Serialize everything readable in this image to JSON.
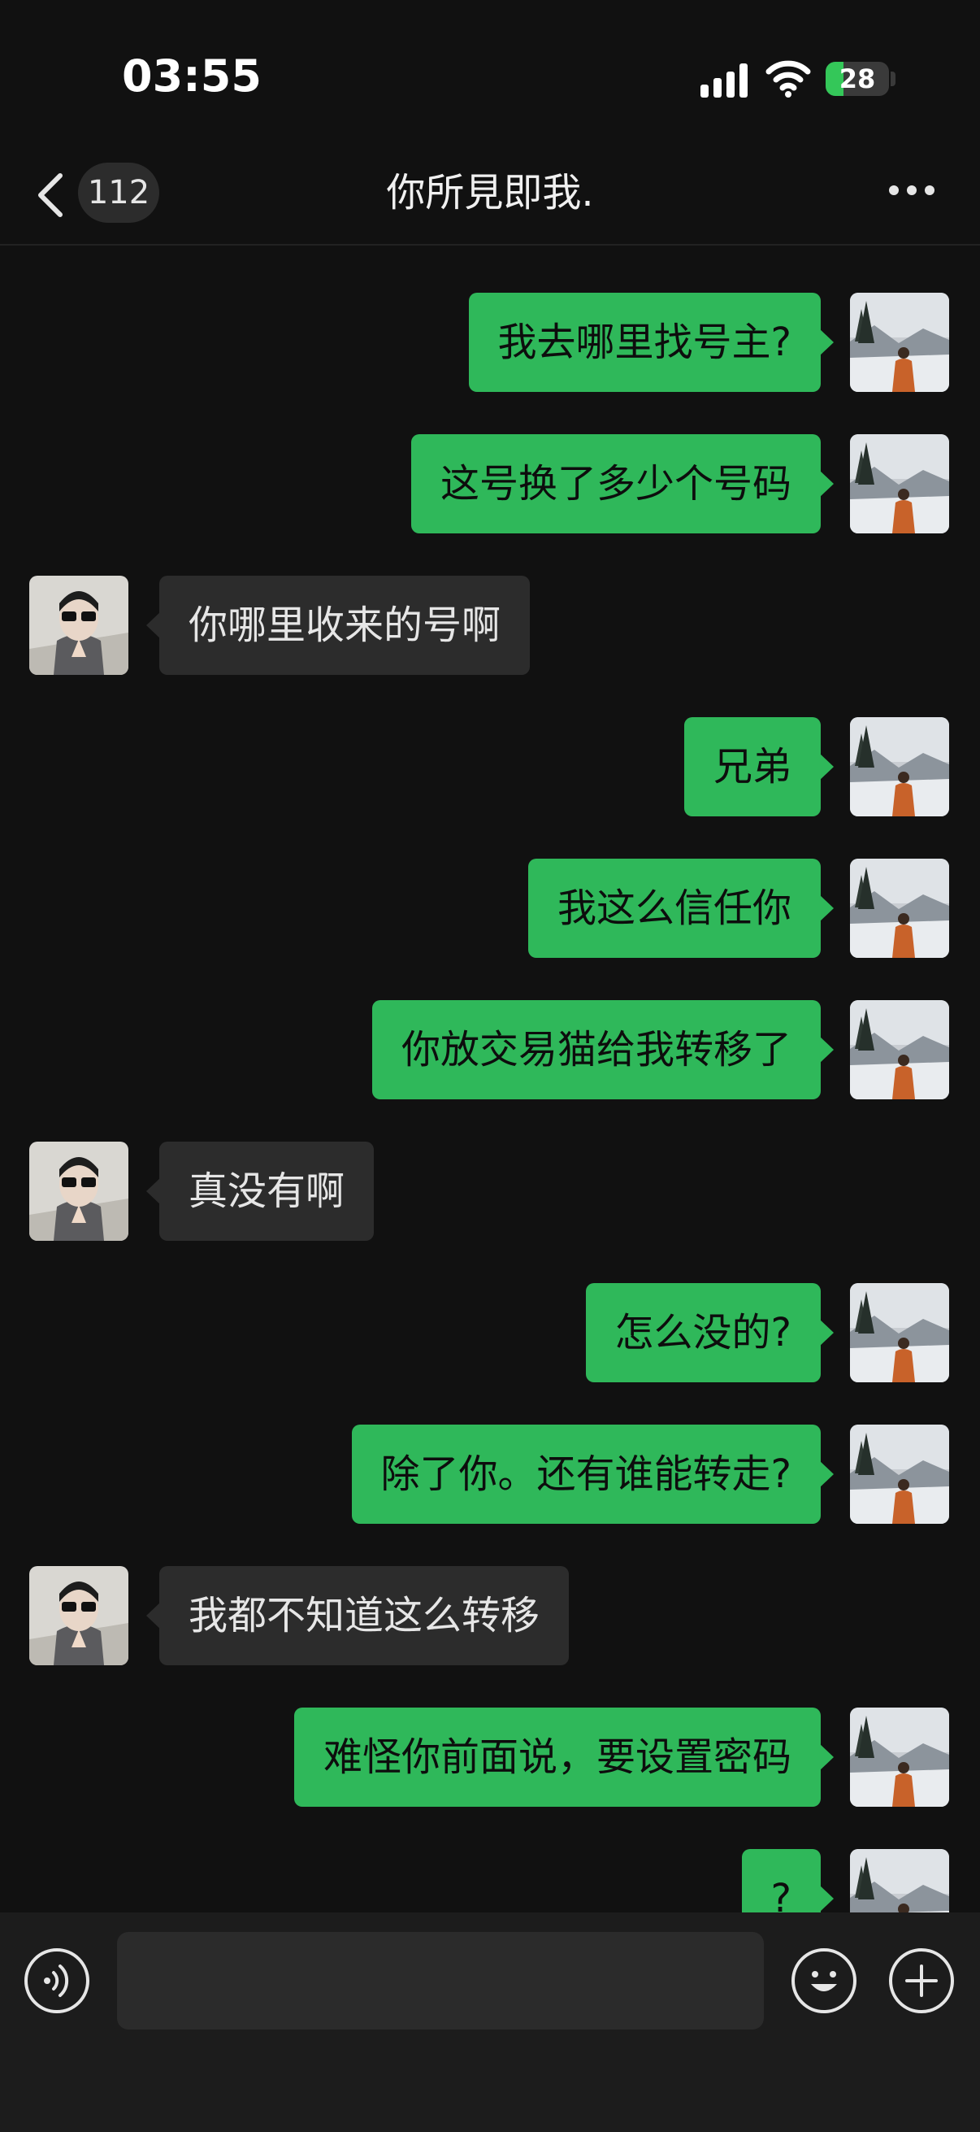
{
  "status_bar": {
    "time": "03:55",
    "battery": "28",
    "battery_level": 0.28,
    "icons": [
      "cellular-signal-icon",
      "wifi-icon",
      "battery-charging-icon"
    ]
  },
  "nav": {
    "back_icon": "chevron-left-icon",
    "unread_count": "112",
    "title": "你所見即我.",
    "more_icon": "more-dots-icon"
  },
  "messages": [
    {
      "from": "me",
      "text": "我去哪里找号主?"
    },
    {
      "from": "me",
      "text": "这号换了多少个号码"
    },
    {
      "from": "other",
      "text": "你哪里收来的号啊"
    },
    {
      "from": "me",
      "text": "兄弟"
    },
    {
      "from": "me",
      "text": "我这么信任你"
    },
    {
      "from": "me",
      "text": "你放交易猫给我转移了"
    },
    {
      "from": "other",
      "text": "真没有啊"
    },
    {
      "from": "me",
      "text": "怎么没的?"
    },
    {
      "from": "me",
      "text": "除了你。还有谁能转走?"
    },
    {
      "from": "other",
      "text": "我都不知道这么转移"
    },
    {
      "from": "me",
      "text": "难怪你前面说，要设置密码"
    },
    {
      "from": "me",
      "text": "?"
    }
  ],
  "input_bar": {
    "value": "",
    "placeholder": "",
    "voice_icon": "voice-icon",
    "emoji_icon": "emoji-icon",
    "plus_icon": "plus-icon"
  },
  "colors": {
    "background": "#111111",
    "my_bubble": "#2fb85a",
    "their_bubble": "#2c2c2c",
    "input_bar": "#1c1c1c"
  }
}
